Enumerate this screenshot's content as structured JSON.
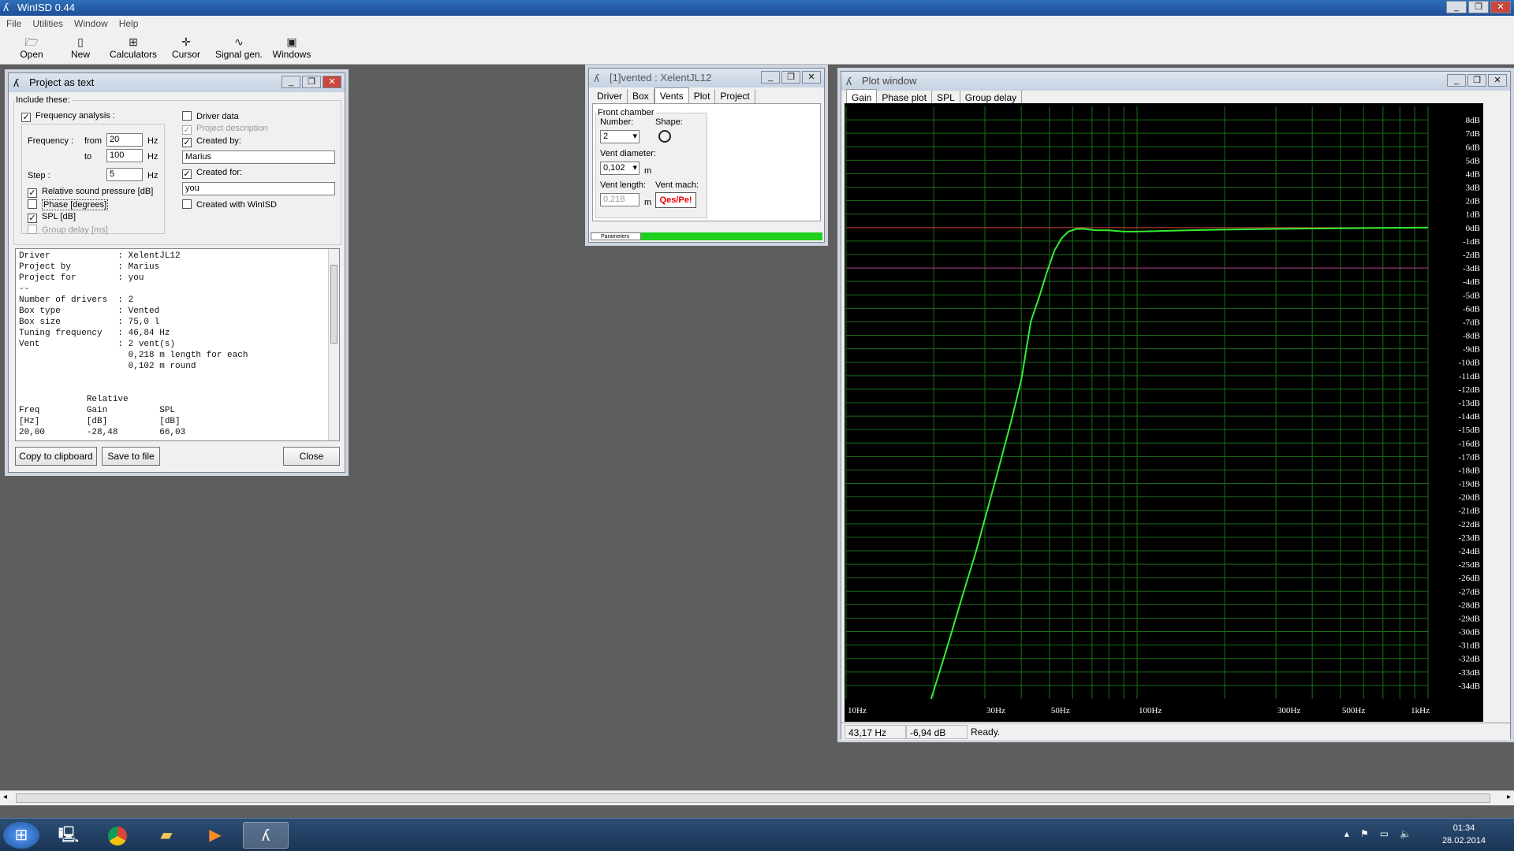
{
  "app": {
    "title": "WinISD 0.44"
  },
  "menu": [
    "File",
    "Utilities",
    "Window",
    "Help"
  ],
  "toolbar": [
    {
      "label": "Open",
      "icon": "folder-open-icon"
    },
    {
      "label": "New",
      "icon": "new-document-icon"
    },
    {
      "label": "Calculators",
      "icon": "calculator-icon"
    },
    {
      "label": "Cursor",
      "icon": "cursor-icon"
    },
    {
      "label": "Signal gen.",
      "icon": "signal-generator-icon"
    },
    {
      "label": "Windows",
      "icon": "windows-icon"
    }
  ],
  "project_text": {
    "title": "Project as text",
    "include_legend": "Include these:",
    "freq_analysis": "Frequency analysis :",
    "frequency_label": "Frequency :",
    "from_label": "from",
    "from_value": "20",
    "to_label": "to",
    "to_value": "100",
    "hz": "Hz",
    "step_label": "Step :",
    "step_value": "5",
    "rel_spl": "Relative sound pressure [dB]",
    "phase": "Phase [degrees]",
    "spl": "SPL [dB]",
    "group_delay": "Group delay [ms]",
    "driver_data": "Driver data",
    "project_description": "Project description",
    "created_by": "Created by:",
    "created_by_value": "Marius",
    "created_for": "Created for:",
    "created_for_value": "you",
    "created_with": "Created with WinISD",
    "text": "Driver             : XelentJL12\nProject by         : Marius\nProject for        : you\n--\nNumber of drivers  : 2\nBox type           : Vented\nBox size           : 75,0 l\nTuning frequency   : 46,84 Hz\nVent               : 2 vent(s)\n                     0,218 m length for each\n                     0,102 m round\n\n\n             Relative\nFreq         Gain          SPL\n[Hz]         [dB]          [dB]\n20,00        -28,48        66,03",
    "copy_button": "Copy to clipboard",
    "save_button": "Save to file",
    "close_button": "Close"
  },
  "vented": {
    "title": "[1]vented : XelentJL12",
    "tabs": [
      "Driver",
      "Box",
      "Vents",
      "Plot",
      "Project"
    ],
    "active_tab": "Vents",
    "front_chamber": "Front chamber",
    "number_label": "Number:",
    "number_value": "2",
    "shape_label": "Shape:",
    "vent_diameter_label": "Vent diameter:",
    "vent_diameter_value": "0,102",
    "unit_m": "m",
    "vent_length_label": "Vent length:",
    "vent_length_value": "0,218",
    "vent_mach_label": "Vent mach:",
    "qes_button": "Qes/Pe!",
    "params_label": "Parameters"
  },
  "plot": {
    "title": "Plot window",
    "tabs": [
      "Gain",
      "Phase plot",
      "SPL",
      "Group delay"
    ],
    "active_tab": "Gain",
    "x_labels": [
      {
        "t": "10Hz",
        "f": 10
      },
      {
        "t": "30Hz",
        "f": 30
      },
      {
        "t": "50Hz",
        "f": 50
      },
      {
        "t": "100Hz",
        "f": 100
      },
      {
        "t": "300Hz",
        "f": 300
      },
      {
        "t": "500Hz",
        "f": 500
      },
      {
        "t": "1kHz",
        "f": 1000
      }
    ],
    "status_freq": "43,17 Hz",
    "status_db": "-6,94 dB",
    "status_text": "Ready."
  },
  "chart_data": {
    "type": "line",
    "xlabel": "",
    "ylabel": "",
    "x_scale": "log",
    "xlim": [
      10,
      1000
    ],
    "ylim": [
      -35,
      9
    ],
    "grid": true,
    "y_ticks": [
      "8dB",
      "7dB",
      "6dB",
      "5dB",
      "4dB",
      "3dB",
      "2dB",
      "1dB",
      "0dB",
      "-1dB",
      "-2dB",
      "-3dB",
      "-4dB",
      "-5dB",
      "-6dB",
      "-7dB",
      "-8dB",
      "-9dB",
      "-10dB",
      "-11dB",
      "-12dB",
      "-13dB",
      "-14dB",
      "-15dB",
      "-16dB",
      "-17dB",
      "-18dB",
      "-19dB",
      "-20dB",
      "-21dB",
      "-22dB",
      "-23dB",
      "-24dB",
      "-25dB",
      "-26dB",
      "-27dB",
      "-28dB",
      "-29dB",
      "-30dB",
      "-31dB",
      "-32dB",
      "-33dB",
      "-34dB"
    ],
    "y_tick_values": [
      8,
      7,
      6,
      5,
      4,
      3,
      2,
      1,
      0,
      -1,
      -2,
      -3,
      -4,
      -5,
      -6,
      -7,
      -8,
      -9,
      -10,
      -11,
      -12,
      -13,
      -14,
      -15,
      -16,
      -17,
      -18,
      -19,
      -20,
      -21,
      -22,
      -23,
      -24,
      -25,
      -26,
      -27,
      -28,
      -29,
      -30,
      -31,
      -32,
      -33,
      -34
    ],
    "reference_lines": [
      0,
      -3
    ],
    "series": [
      {
        "color": "#33ee33",
        "x": [
          19.6,
          22,
          25,
          28,
          31,
          34,
          37,
          40,
          43.17,
          46,
          49,
          52,
          55,
          58,
          62,
          66,
          72,
          80,
          90,
          100,
          120,
          150,
          200,
          300,
          500,
          1000
        ],
        "y": [
          -35,
          -31.5,
          -27.5,
          -24,
          -20.5,
          -17.3,
          -14.3,
          -11.3,
          -6.94,
          -5.2,
          -3.3,
          -1.7,
          -0.8,
          -0.3,
          -0.1,
          -0.1,
          -0.2,
          -0.2,
          -0.3,
          -0.3,
          -0.25,
          -0.2,
          -0.15,
          -0.1,
          -0.05,
          0
        ]
      }
    ]
  },
  "taskbar": {
    "time": "01:34",
    "date": "28.02.2014"
  },
  "colors": {
    "plot_bg": "#000000",
    "grid": "#1b6d1b",
    "curve": "#33ee33",
    "zero_line": "#cc3333",
    "minus3_line": "#b03080"
  }
}
